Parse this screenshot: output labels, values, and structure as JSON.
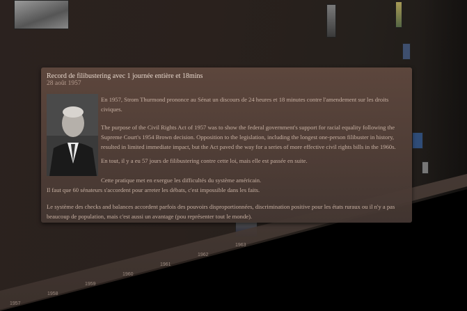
{
  "card": {
    "title": "Record de filibustering avec 1 journée entière et 18mins",
    "date": "28 août 1957",
    "image_icon": "portrait-photo",
    "paragraphs": [
      "En 1957, Strom Thurmond prononce au Sénat un discours de 24 heures et 18 minutes contre l'amendement sur les droits civiques.",
      "The purpose of the Civil Rights Act of 1957 was to show the federal government's support for racial equality following the Supreme Court's 1954 Brown decision. Opposition to the legislation, including the longest one-person filibuster in history, resulted in limited immediate impact, but the Act paved the way for a series of more effective civil rights bills in the 1960s.",
      "En tout, il y a eu 57 jours de filibustering contre cette loi, mais elle est passée en suite.",
      "Cette pratique met en exergue les difficultés du système américain.",
      "Il faut que 60 sénateurs s'accordent pour arreter les débats, c'est impossible dans les faits.",
      "Le système des checks and balances accordent parfois des pouvoirs disproportionnées, discrimination positive pour les états ruraux ou il n'y a pas beaucoup de population, mais c'est aussi un avantage (pou représenter tout le monde)."
    ]
  },
  "timeline": {
    "ticks": [
      "1957",
      "1958",
      "1959",
      "1960",
      "1961",
      "1962",
      "1963"
    ],
    "colors": {
      "wall": "#2a211d",
      "card": "#5f483e",
      "text": "#c8b1a3"
    }
  }
}
